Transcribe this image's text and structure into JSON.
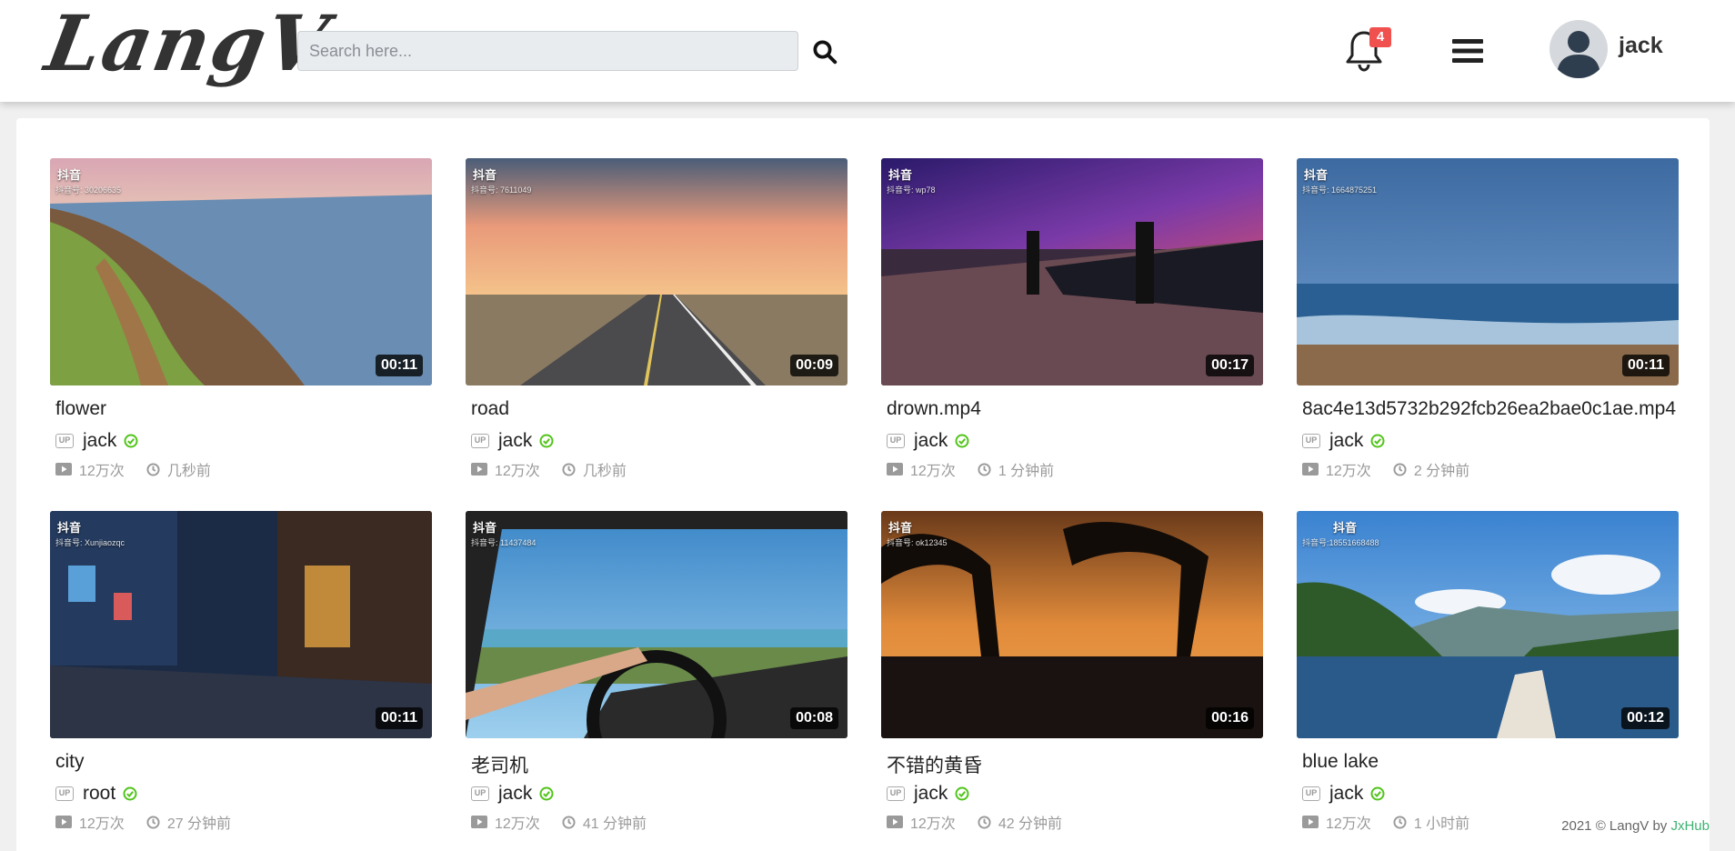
{
  "header": {
    "logo": "LangV",
    "search_placeholder": "Search here...",
    "notification_count": "4",
    "username": "jack"
  },
  "videos": [
    {
      "title": "flower",
      "author": "jack",
      "views": "12万次",
      "time": "几秒前",
      "duration": "00:11",
      "tiktok_label": "抖音",
      "tiktok_id": "抖音号: 30206635"
    },
    {
      "title": "road",
      "author": "jack",
      "views": "12万次",
      "time": "几秒前",
      "duration": "00:09",
      "tiktok_label": "抖音",
      "tiktok_id": "抖音号: 7611049"
    },
    {
      "title": "drown.mp4",
      "author": "jack",
      "views": "12万次",
      "time": "1 分钟前",
      "duration": "00:17",
      "tiktok_label": "抖音",
      "tiktok_id": "抖音号: wp78"
    },
    {
      "title": "8ac4e13d5732b292fcb26ea2bae0c1ae.mp4",
      "author": "jack",
      "views": "12万次",
      "time": "2 分钟前",
      "duration": "00:11",
      "tiktok_label": "抖音",
      "tiktok_id": "抖音号: 1664875251"
    },
    {
      "title": "city",
      "author": "root",
      "views": "12万次",
      "time": "27 分钟前",
      "duration": "00:11",
      "tiktok_label": "抖音",
      "tiktok_id": "抖音号: Xunjiaozqc"
    },
    {
      "title": "老司机",
      "author": "jack",
      "views": "12万次",
      "time": "41 分钟前",
      "duration": "00:08",
      "tiktok_label": "抖音",
      "tiktok_id": "抖音号: 11437484"
    },
    {
      "title": "不错的黄昏",
      "author": "jack",
      "views": "12万次",
      "time": "42 分钟前",
      "duration": "00:16",
      "tiktok_label": "抖音",
      "tiktok_id": "抖音号: ok12345"
    },
    {
      "title": "blue lake",
      "author": "jack",
      "views": "12万次",
      "time": "1 小时前",
      "duration": "00:12",
      "tiktok_label": "抖音",
      "tiktok_id": "抖音号:18551668488"
    }
  ],
  "footer": {
    "copyright": "2021 © LangV by ",
    "brand": "JxHub"
  },
  "icons": {
    "search": "search-icon",
    "notification": "bell-icon",
    "menu": "hamburger-menu-icon",
    "avatar": "user-avatar-icon",
    "verified": "check-circle-icon",
    "views": "play-icon",
    "time": "clock-icon"
  },
  "colors": {
    "badge": "#f0514f",
    "verified": "#52c41a",
    "brand_link": "#3cb371"
  }
}
